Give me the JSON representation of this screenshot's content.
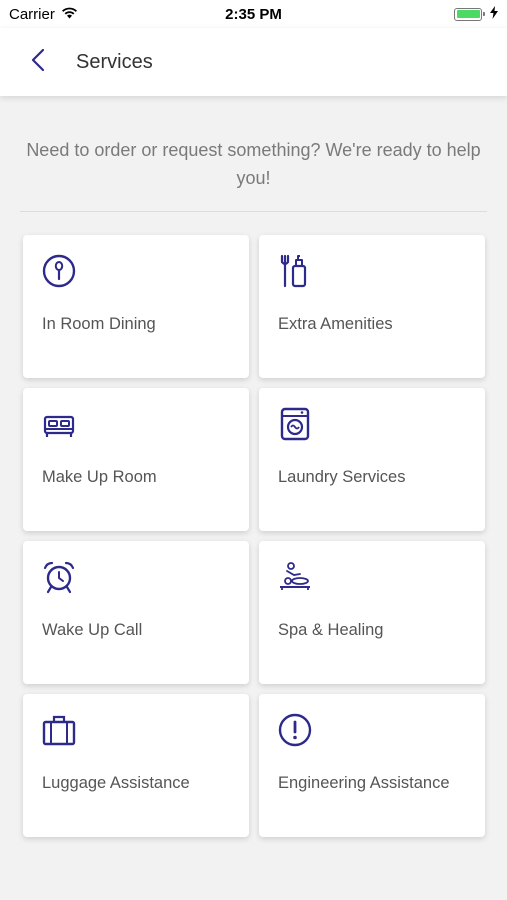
{
  "status_bar": {
    "carrier": "Carrier",
    "time": "2:35 PM"
  },
  "nav": {
    "title": "Services",
    "back_icon": "chevron-left-icon"
  },
  "intro_text": "Need to order or request something? We're ready to help you!",
  "colors": {
    "accent": "#2e2a8c",
    "battery": "#4cd964"
  },
  "services": [
    {
      "label": "In Room Dining",
      "icon": "dining-icon"
    },
    {
      "label": "Extra Amenities",
      "icon": "amenities-icon"
    },
    {
      "label": "Make Up Room",
      "icon": "bed-icon"
    },
    {
      "label": "Laundry Services",
      "icon": "laundry-icon"
    },
    {
      "label": "Wake Up Call",
      "icon": "alarm-clock-icon"
    },
    {
      "label": "Spa & Healing",
      "icon": "spa-icon"
    },
    {
      "label": "Luggage Assistance",
      "icon": "luggage-icon"
    },
    {
      "label": "Engineering Assistance",
      "icon": "alert-icon"
    }
  ]
}
